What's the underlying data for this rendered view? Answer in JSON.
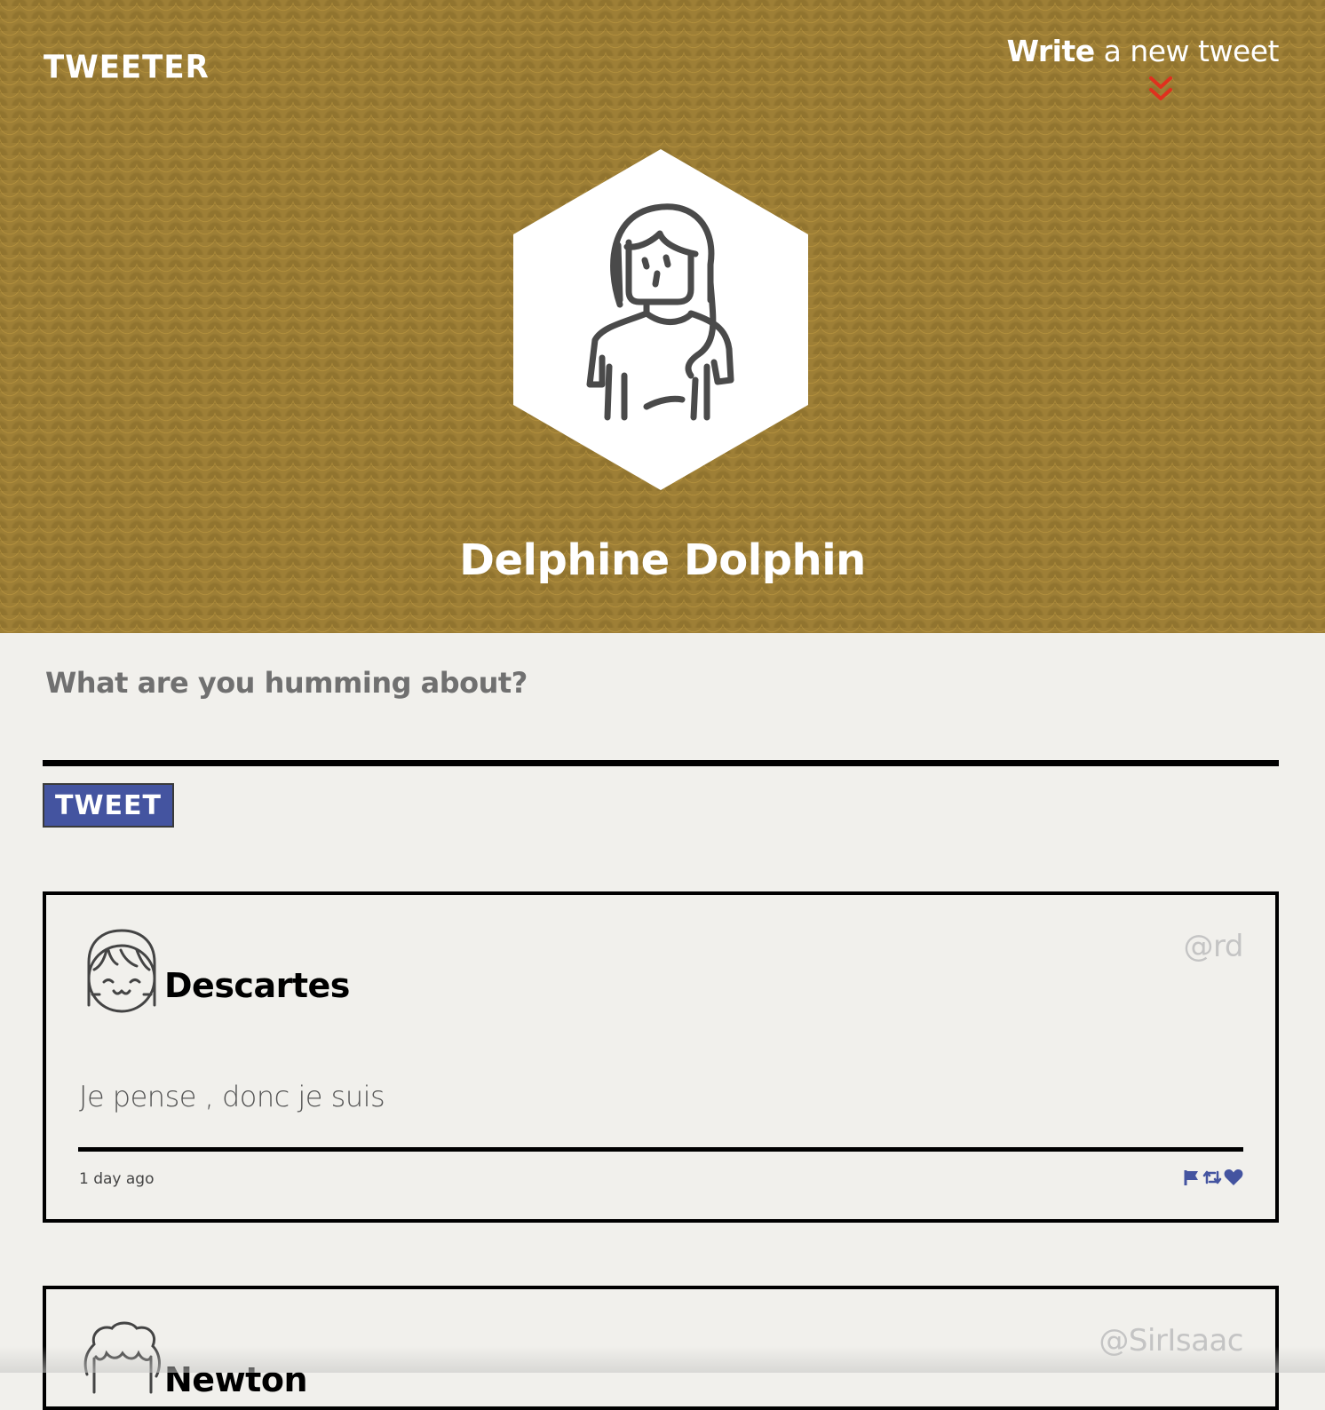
{
  "header": {
    "brand": "TWEETER",
    "write_strong": "Write",
    "write_rest": " a new tweet",
    "profile_name": "Delphine Dolphin"
  },
  "compose": {
    "label": "What are you humming about?",
    "value": "",
    "button_label": "TWEET"
  },
  "tweets": [
    {
      "name": "Descartes",
      "handle": "@rd",
      "text": "Je pense , donc je suis",
      "time": "1 day ago"
    },
    {
      "name": "Newton",
      "handle": "@SirIsaac"
    }
  ],
  "colors": {
    "banner": "#9e7f36",
    "accent_blue": "#4454a0",
    "chevron_red": "#e0301e",
    "page_bg": "#f1f0ec"
  },
  "icons": [
    "chevron-double-down-icon",
    "flag-icon",
    "retweet-icon",
    "heart-icon"
  ]
}
